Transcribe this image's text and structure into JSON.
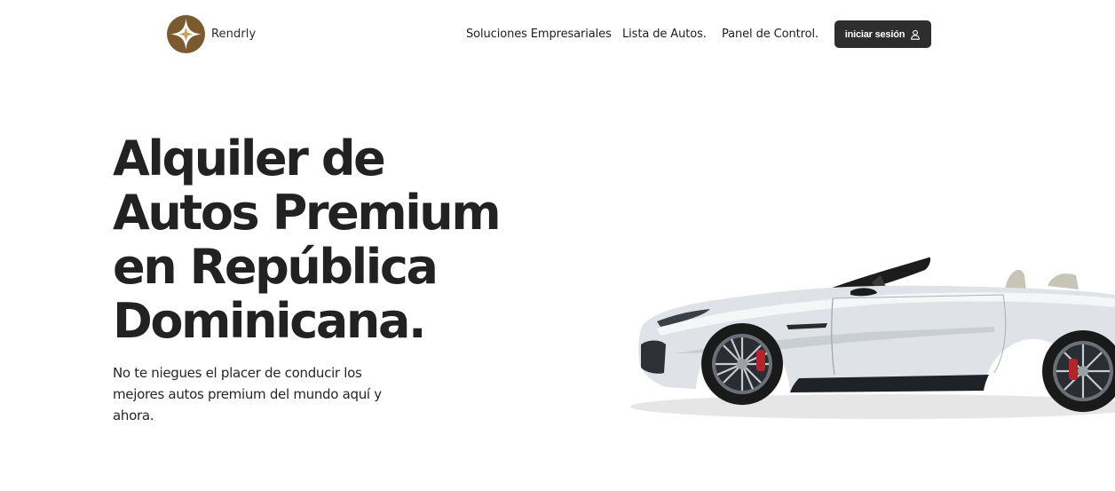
{
  "brand": {
    "name": "Rendrly",
    "logo_icon": "compass-star-logo",
    "logo_color": "#7a5a2e"
  },
  "nav": {
    "links": [
      "Soluciones Empresariales",
      "Lista de Autos.",
      "Panel de Control."
    ],
    "login_label": "iniciar sesión",
    "login_icon": "user-icon",
    "login_bg": "#2e2e2e"
  },
  "hero": {
    "title_lines": [
      "Alquiler de",
      "Autos Premium",
      "en República",
      "Dominicana."
    ],
    "subtitle": "No te niegues el placer de conducir los mejores autos premium del mundo aquí y ahora.",
    "image": "white-convertible-sports-car"
  }
}
